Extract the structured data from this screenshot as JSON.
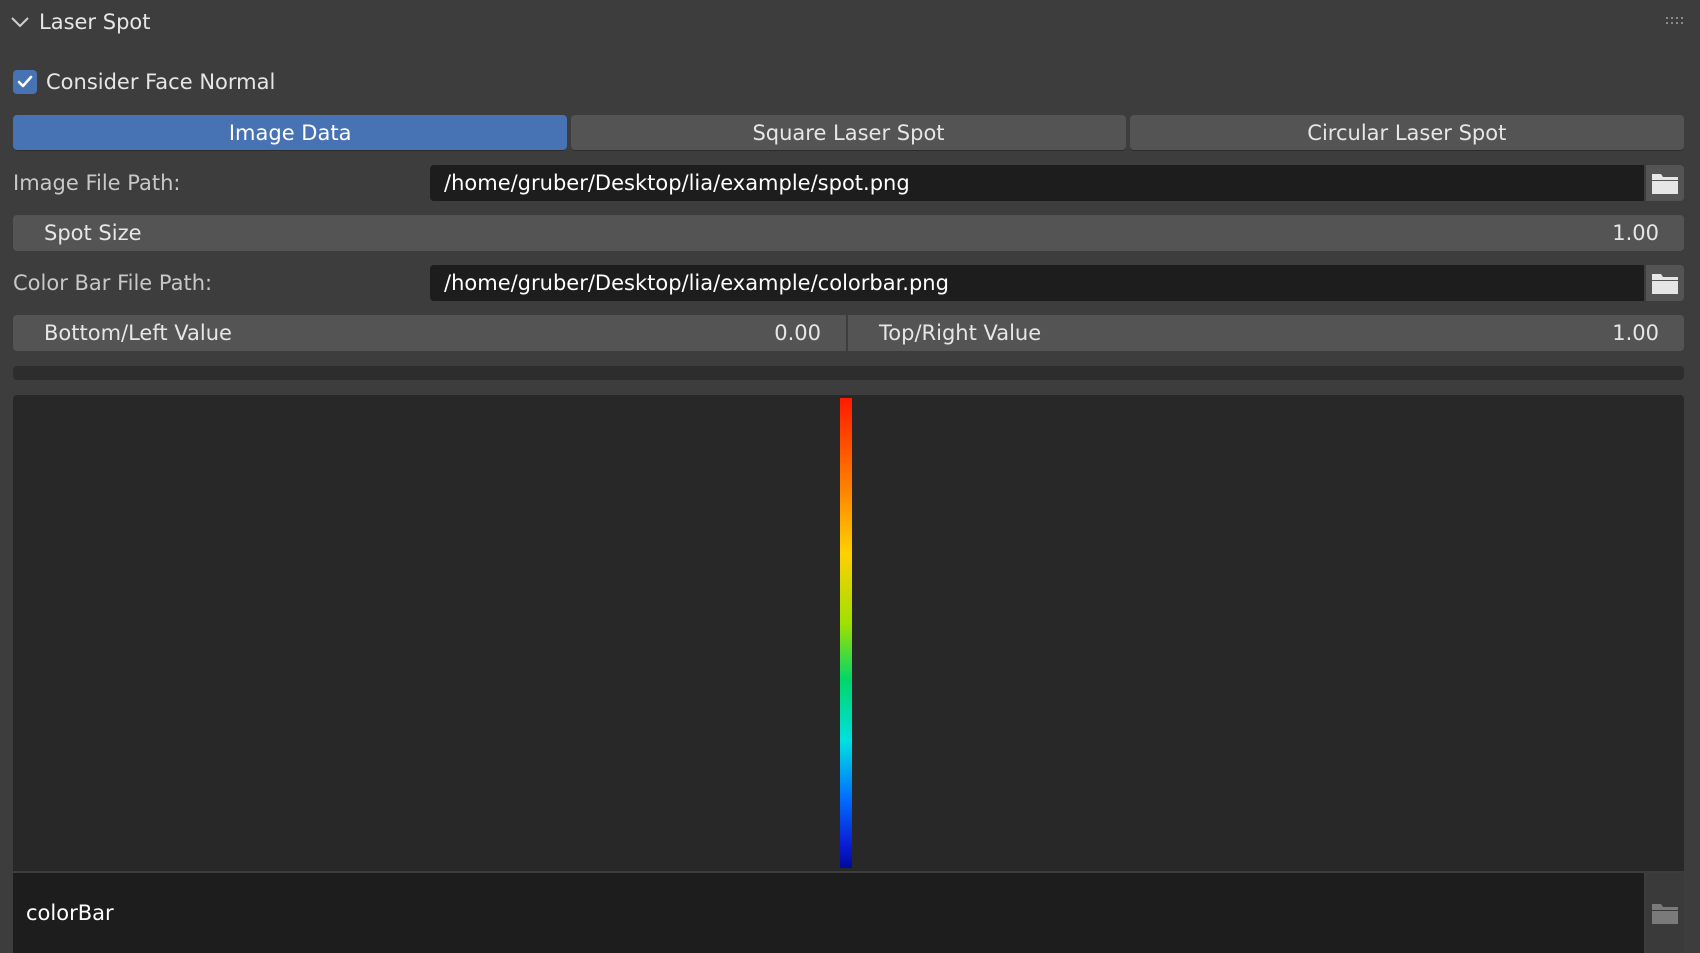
{
  "panel": {
    "title": "Laser Spot",
    "collapse_icon": "chevron-down-icon",
    "drag_icon": "drag-handle-icon"
  },
  "consider_face_normal": {
    "label": "Consider Face Normal",
    "checked": true
  },
  "tabs": [
    {
      "label": "Image Data",
      "active": true
    },
    {
      "label": "Square Laser Spot",
      "active": false
    },
    {
      "label": "Circular Laser Spot",
      "active": false
    }
  ],
  "image_file_path": {
    "label": "Image File Path:",
    "value": "/home/gruber/Desktop/lia/example/spot.png",
    "icon": "folder-icon"
  },
  "spot_size": {
    "label": "Spot Size",
    "value": "1.00"
  },
  "color_bar_file_path": {
    "label": "Color Bar File Path:",
    "value": "/home/gruber/Desktop/lia/example/colorbar.png",
    "icon": "folder-icon"
  },
  "range": {
    "bottom_left": {
      "label": "Bottom/Left Value",
      "value": "0.00"
    },
    "top_right": {
      "label": "Top/Right Value",
      "value": "1.00"
    }
  },
  "image_preview": {
    "image_name": "colorBar",
    "icon": "folder-icon"
  },
  "colors": {
    "accent": "#4772b3",
    "panel_bg": "#3d3d3d",
    "field_bg": "#1d1d1d",
    "button_bg": "#545454"
  }
}
